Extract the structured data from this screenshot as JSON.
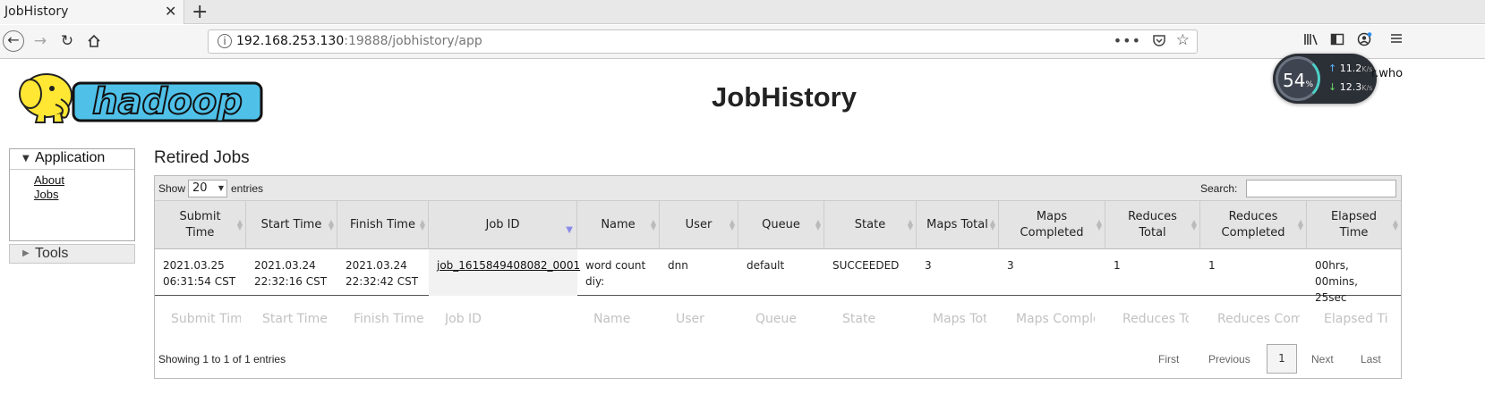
{
  "browser": {
    "tab_title": "JobHistory",
    "tab_close": "✕",
    "new_tab": "+",
    "url_host": "192.168.253.130",
    "url_rest": ":19888/jobhistory/app"
  },
  "net_widget": {
    "percent": "54",
    "percent_sign": "%",
    "upload": "11.2",
    "download": "12.3",
    "unit": "K/s",
    "partial_text": "r.who"
  },
  "header": {
    "logo_text": "hadoop",
    "title": "JobHistory"
  },
  "sidebar": {
    "application_label": "Application",
    "links": [
      "About",
      "Jobs"
    ],
    "tools_label": "Tools"
  },
  "main": {
    "section_title": "Retired Jobs",
    "show_label": "Show",
    "entries_value": "20",
    "entries_label": "entries",
    "search_label": "Search:",
    "columns": [
      "Submit Time",
      "Start Time",
      "Finish Time",
      "Job ID",
      "Name",
      "User",
      "Queue",
      "State",
      "Maps Total",
      "Maps Completed",
      "Reduces Total",
      "Reduces Completed",
      "Elapsed Time"
    ],
    "rows": [
      {
        "submit_time": "2021.03.25 06:31:54 CST",
        "start_time": "2021.03.24 22:32:16 CST",
        "finish_time": "2021.03.24 22:32:42 CST",
        "job_id": "job_1615849408082_0001",
        "name": "word count diy:",
        "user": "dnn",
        "queue": "default",
        "state": "SUCCEEDED",
        "maps_total": "3",
        "maps_completed": "3",
        "reduces_total": "1",
        "reduces_completed": "1",
        "elapsed_time": "00hrs, 00mins, 25sec"
      }
    ],
    "filter_placeholders": [
      "Submit Tim",
      "Start Time",
      "Finish Time",
      "Job ID",
      "Name",
      "User",
      "Queue",
      "State",
      "Maps Tota",
      "Maps Complet",
      "Reduces To",
      "Reduces Com",
      "Elapsed Tin"
    ],
    "info": "Showing 1 to 1 of 1 entries",
    "pager": {
      "first": "First",
      "previous": "Previous",
      "current": "1",
      "next": "Next",
      "last": "Last"
    }
  }
}
